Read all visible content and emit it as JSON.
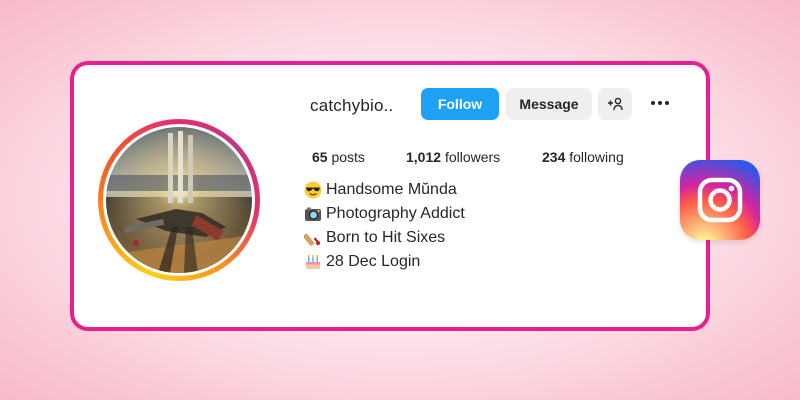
{
  "profile": {
    "username": "catchybio..",
    "follow_label": "Follow",
    "message_label": "Message",
    "add_user_icon": "add-user-icon",
    "more_icon": "more-options-icon"
  },
  "stats": {
    "posts_count": "65",
    "posts_label": "posts",
    "followers_count": "1,012",
    "followers_label": "followers",
    "following_count": "234",
    "following_label": "following"
  },
  "bio": [
    {
      "icon": "sunglasses-emoji",
      "text": "Handsome Mŭnda"
    },
    {
      "icon": "camera-emoji",
      "text": "Photography Addict"
    },
    {
      "icon": "cricket-bat-emoji",
      "text": "Born to Hit Sixes"
    },
    {
      "icon": "birthday-cake-emoji",
      "text": "28 Dec Login"
    }
  ],
  "colors": {
    "card_border": "#ea1f8f",
    "follow_button": "#1ea1f7",
    "secondary_button": "#efefef",
    "text": "#262626"
  },
  "logo": "instagram-logo-icon"
}
